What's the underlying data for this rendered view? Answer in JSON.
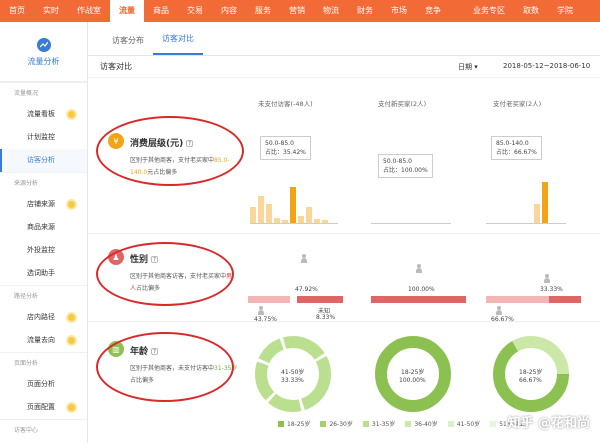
{
  "topnav": {
    "items": [
      "首页",
      "实时",
      "作战室",
      "流量",
      "商品",
      "交易",
      "内容",
      "服务",
      "营销",
      "物流",
      "财务",
      "市场",
      "竞争",
      "业务专区",
      "取数",
      "学院"
    ],
    "active_index": 3,
    "badges": {
      "作战室": "·",
      "内容": "·"
    }
  },
  "sidebar": {
    "title": "流量分析",
    "groups": [
      {
        "label": "流量概况",
        "items": [
          {
            "label": "流量看板",
            "dot": true
          },
          {
            "label": "计划监控",
            "dot": false
          },
          {
            "label": "访客分析",
            "dot": false,
            "active": true
          }
        ]
      },
      {
        "label": "来源分析",
        "items": [
          {
            "label": "店铺来源",
            "dot": true
          },
          {
            "label": "商品来源",
            "dot": false
          },
          {
            "label": "外投监控",
            "dot": false
          },
          {
            "label": "选词助手",
            "dot": false
          }
        ]
      },
      {
        "label": "路径分析",
        "items": [
          {
            "label": "店内路径",
            "dot": true
          },
          {
            "label": "流量去向",
            "dot": true
          }
        ]
      },
      {
        "label": "页面分析",
        "items": [
          {
            "label": "页面分析",
            "dot": false
          },
          {
            "label": "页面配置",
            "dot": true
          }
        ]
      },
      {
        "label": "访客中心",
        "items": []
      }
    ]
  },
  "tabs": [
    {
      "label": "访客分布",
      "active": false
    },
    {
      "label": "访客对比",
      "active": true
    }
  ],
  "section": {
    "title": "访客对比",
    "filter_label": "日期",
    "date_range": "2018-05-12~2018-06-10"
  },
  "columns": [
    "未支付访客(-48人)",
    "支付新买家(2人)",
    "支付老买家(2人)"
  ],
  "rows": {
    "consumption": {
      "title": "消费层级(元)",
      "desc_prefix": "区别于其他商客，支付老买家中",
      "desc_highlight": "85.0-140.0",
      "desc_suffix": "元占比偏多",
      "charts": [
        {
          "tip_range": "50.0-85.0",
          "tip_ratio": "占比：35.42%",
          "values": [
            0.3,
            0.5,
            0.35,
            0.1,
            0.05,
            0.65,
            0.12,
            0.3,
            0.08,
            0.05
          ]
        },
        {
          "tip_range": "50.0-85.0",
          "tip_ratio": "占比：100.00%",
          "values": [
            0,
            0,
            0,
            0,
            0,
            0,
            0,
            0,
            0,
            0
          ]
        },
        {
          "tip_range": "85.0-140.0",
          "tip_ratio": "占比：66.67%",
          "values": [
            0,
            0,
            0,
            0,
            0,
            0,
            0.35,
            0.75,
            0,
            0
          ]
        }
      ]
    },
    "gender": {
      "title": "性别",
      "desc_prefix": "区别于其他商客访客，支付老买家中",
      "desc_highlight": "男人",
      "desc_suffix": "占比偏多",
      "charts": [
        {
          "male": "47.92%",
          "female": "43.75%",
          "unknown_label": "未知",
          "unknown": "8.33%",
          "male_frac": 0.4792,
          "female_frac": 0.4375
        },
        {
          "top": "100.00%",
          "bottom": "",
          "top_frac": 1.0
        },
        {
          "top": "33.33%",
          "bottom": "66.67%",
          "top_frac": 0.3333
        }
      ]
    },
    "age": {
      "title": "年龄",
      "desc_prefix": "区别于其他商客，未支付访客中",
      "desc_highlight": "31-35岁",
      "desc_suffix": "占比偏多",
      "charts": [
        {
          "range": "41-50岁",
          "value": "33.33%"
        },
        {
          "range": "18-25岁",
          "value": "100.00%"
        },
        {
          "range": "18-25岁",
          "value": "66.67%"
        }
      ]
    }
  },
  "legend": [
    {
      "label": "18-25岁",
      "color": "#8cc152"
    },
    {
      "label": "26-30岁",
      "color": "#a0d468"
    },
    {
      "label": "31-35岁",
      "color": "#b9df8f"
    },
    {
      "label": "36-40岁",
      "color": "#cbe8a9"
    },
    {
      "label": "41-50岁",
      "color": "#dcefc6"
    },
    {
      "label": "51岁以上",
      "color": "#e8f4db"
    }
  ],
  "watermark": "知乎 @花和尚",
  "colors": {
    "accent": "#f26a35",
    "link": "#3a7bd5",
    "orange": "#f2a417",
    "red": "#e06666",
    "pink": "#f4b5b5",
    "green": "#8cc152"
  }
}
